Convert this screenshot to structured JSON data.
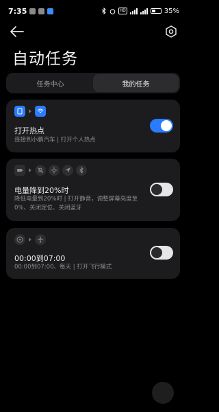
{
  "status_bar": {
    "time": "7:35",
    "battery": "35%",
    "hd_label": "HD"
  },
  "header": {
    "title": "自动任务"
  },
  "tabs": [
    {
      "label": "任务中心",
      "active": false
    },
    {
      "label": "我的任务",
      "active": true
    }
  ],
  "tasks": [
    {
      "title": "打开热点",
      "description": "连接到小鹏汽车 | 打开个人热点",
      "enabled": true,
      "icons": [
        "phone-app-icon",
        "wifi-hotspot-icon"
      ]
    },
    {
      "title": "电量降到20%时",
      "description": "降低电量到20%时 | 打开静音，调整屏幕亮度至0%、关闭定位、关闭蓝牙",
      "enabled": false,
      "icons": [
        "battery-icon",
        "mute-icon",
        "brightness-icon",
        "location-icon",
        "bluetooth-icon"
      ]
    },
    {
      "title": "00:00到07:00",
      "description": "00:00到07:00、每天 | 打开飞行模式",
      "enabled": false,
      "icons": [
        "clock-icon",
        "airplane-icon"
      ]
    }
  ],
  "colors": {
    "accent": "#2b7bff",
    "card_bg": "#1c1c1e",
    "page_bg": "#000000"
  }
}
